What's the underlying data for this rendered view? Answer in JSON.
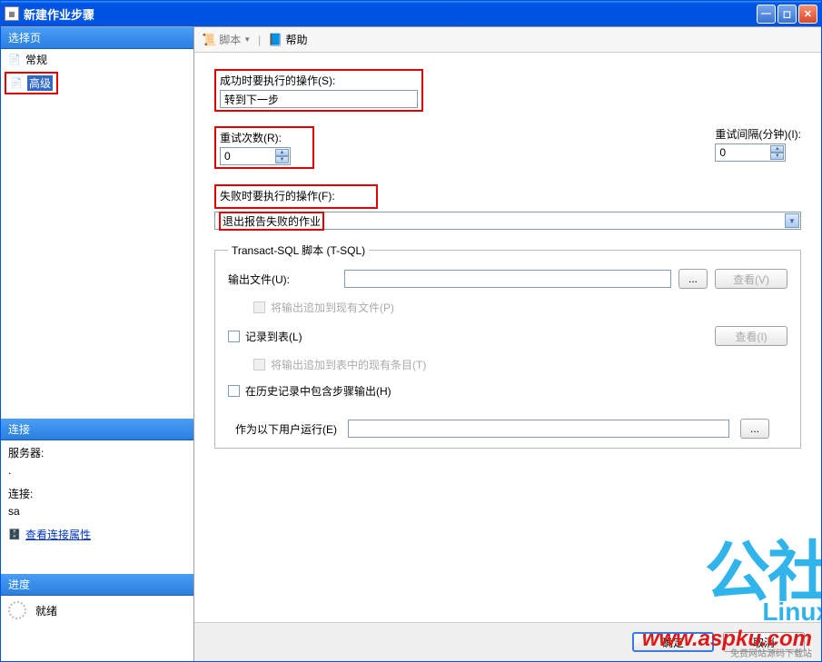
{
  "window": {
    "title": "新建作业步骤"
  },
  "sidebar": {
    "section_select": "选择页",
    "items": [
      "常规",
      "高级"
    ],
    "section_conn": "连接",
    "server_label": "服务器:",
    "server_value": ".",
    "conn_label": "连接:",
    "conn_value": "sa",
    "view_conn": "查看连接属性",
    "section_progress": "进度",
    "status": "就绪"
  },
  "toolbar": {
    "script": "脚本",
    "help": "帮助"
  },
  "form": {
    "success_label": "成功时要执行的操作(S):",
    "success_value": "转到下一步",
    "retry_count_label": "重试次数(R):",
    "retry_count_value": "0",
    "retry_interval_label": "重试间隔(分钟)(I):",
    "retry_interval_value": "0",
    "fail_label": "失败时要执行的操作(F):",
    "fail_value": "退出报告失败的作业",
    "tsql_legend": "Transact-SQL 脚本 (T-SQL)",
    "output_file_label": "输出文件(U):",
    "browse": "...",
    "view_v": "查看(V)",
    "append_file": "将输出追加到现有文件(P)",
    "log_table": "记录到表(L)",
    "view_i": "查看(I)",
    "append_table": "将输出追加到表中的现有条目(T)",
    "history": "在历史记录中包含步骤输出(H)",
    "run_as_label": "作为以下用户运行(E)"
  },
  "buttons": {
    "ok": "确定",
    "cancel": "取消"
  },
  "watermark": {
    "big": "公社",
    "sub": "Linux",
    "url": "www.aspku.com",
    "tag": "免费网站源码下载站"
  }
}
